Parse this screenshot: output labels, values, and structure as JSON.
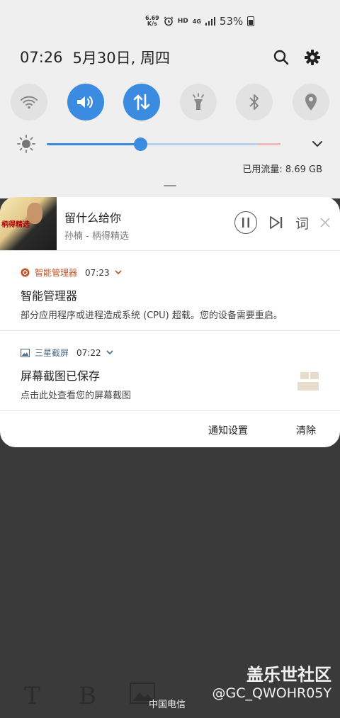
{
  "status_bar": {
    "net_speed_value": "6.69",
    "net_speed_unit": "K/s",
    "hd": "HD",
    "network": "4G",
    "battery": "53%"
  },
  "header": {
    "time": "07:26",
    "date": "5月30日, 周四",
    "icons": [
      "search-icon",
      "gear-icon"
    ]
  },
  "quick_settings": {
    "tiles": [
      {
        "name": "wifi",
        "icon": "wifi-icon",
        "on": false
      },
      {
        "name": "sound",
        "icon": "volume-icon",
        "on": true
      },
      {
        "name": "mobile-data",
        "icon": "data-transfer-icon",
        "on": true
      },
      {
        "name": "flashlight",
        "icon": "flashlight-icon",
        "on": false
      },
      {
        "name": "bluetooth",
        "icon": "bluetooth-icon",
        "on": false
      },
      {
        "name": "location",
        "icon": "location-icon",
        "on": false
      }
    ],
    "brightness_level": 0.4,
    "data_usage": "已用流量: 8.69 GB"
  },
  "media": {
    "album_text": "柄得精选",
    "song": "留什么给你",
    "artist": "孙楠 - 柄得精选",
    "lyrics_label": "词"
  },
  "notifications": [
    {
      "app": "智能管理器",
      "time": "07:23",
      "title": "智能管理器",
      "body": "部分应用程序或进程造成系统 (CPU) 超载。您的设备需要重启。",
      "accent": "#c0532a"
    },
    {
      "app": "三星截屏",
      "time": "07:22",
      "title": "屏幕截图已保存",
      "body": "点击此处查看您的屏幕截图",
      "accent": "#4a6b83"
    }
  ],
  "actions": {
    "settings": "通知设置",
    "clear": "清除"
  },
  "background": {
    "toolbar_letters": [
      "T",
      "B"
    ],
    "carrier": "中国电信",
    "watermark_title": "盖乐世社区",
    "watermark_user": "@GC_QWOHR05Y"
  }
}
